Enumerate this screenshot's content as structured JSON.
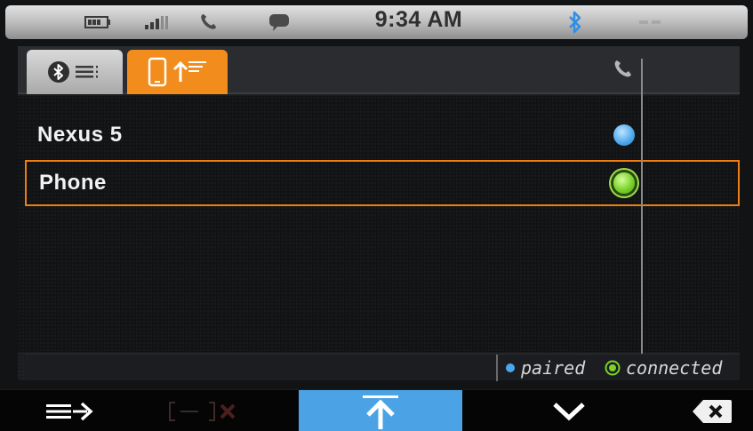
{
  "status_bar": {
    "time": "9:34 AM",
    "icons": [
      "battery-icon",
      "signal-icon",
      "phone-icon",
      "message-icon",
      "bluetooth-icon",
      "blank-indicator"
    ]
  },
  "tabs": [
    {
      "name": "bluetooth-devices-tab",
      "icon": "bluetooth-list-icon",
      "active": false
    },
    {
      "name": "phone-devices-tab",
      "icon": "phone-upload-list-icon",
      "active": true
    }
  ],
  "list_header_icon": "phone-icon",
  "devices": [
    {
      "label": "Nexus 5",
      "status": "paired"
    },
    {
      "label": "Phone",
      "status": "connected",
      "selected": true
    }
  ],
  "legend": {
    "paired": "paired",
    "connected": "connected"
  },
  "bottom_bar": {
    "buttons": [
      {
        "name": "menu-forward-button",
        "icon": "list-arrow-icon",
        "enabled": true
      },
      {
        "name": "disconnect-button",
        "icon": "disconnect-icon",
        "enabled": false
      },
      {
        "name": "upload-button",
        "icon": "arrow-up-icon",
        "enabled": true
      },
      {
        "name": "down-button",
        "icon": "chevron-down-icon",
        "enabled": true
      },
      {
        "name": "delete-button",
        "icon": "backspace-icon",
        "enabled": true
      }
    ]
  },
  "colors": {
    "accent": "#f28c1d",
    "paired": "#4aa7ec",
    "connected": "#7bd22a",
    "action": "#4ba3e6"
  }
}
